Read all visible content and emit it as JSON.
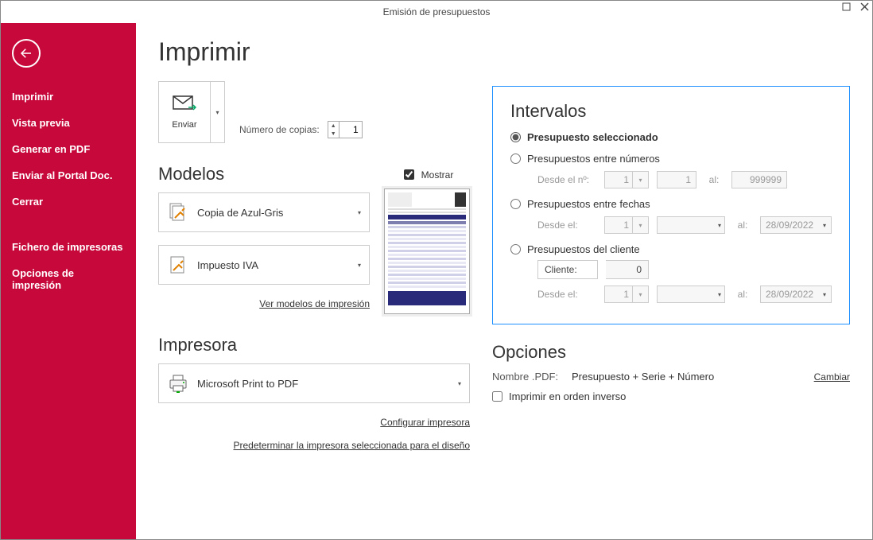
{
  "titlebar": {
    "title": "Emisión de presupuestos"
  },
  "sidebar": {
    "items": [
      "Imprimir",
      "Vista previa",
      "Generar en PDF",
      "Enviar al Portal Doc.",
      "Cerrar"
    ],
    "items2": [
      "Fichero de impresoras",
      "Opciones de impresión"
    ]
  },
  "main": {
    "title": "Imprimir",
    "send_label": "Enviar",
    "copies_label": "Número de copias:",
    "copies_value": "1",
    "modelos_title": "Modelos",
    "mostrar_label": "Mostrar",
    "model1": "Copia de Azul-Gris",
    "model2": "Impuesto IVA",
    "ver_modelos": "Ver modelos de impresión",
    "impresora_title": "Impresora",
    "printer_name": "Microsoft Print to PDF",
    "configurar": "Configurar impresora",
    "predeterminar": "Predeterminar la impresora seleccionada para el diseño"
  },
  "intervalos": {
    "title": "Intervalos",
    "r1": "Presupuesto seleccionado",
    "r2": "Presupuestos entre números",
    "r2_desde": "Desde el nº:",
    "r2_v1": "1",
    "r2_v2": "1",
    "r2_al": "al:",
    "r2_v3": "999999",
    "r3": "Presupuestos entre fechas",
    "r3_desde": "Desde el:",
    "r3_v1": "1",
    "r3_al": "al:",
    "r3_date": "28/09/2022",
    "r4": "Presupuestos del cliente",
    "r4_cliente": "Cliente:",
    "r4_clival": "0",
    "r4_desde": "Desde el:",
    "r4_v1": "1",
    "r4_al": "al:",
    "r4_date": "28/09/2022"
  },
  "opciones": {
    "title": "Opciones",
    "pdf_k": "Nombre .PDF:",
    "pdf_v": "Presupuesto + Serie + Número",
    "cambiar": "Cambiar",
    "inverso": "Imprimir en orden inverso"
  }
}
